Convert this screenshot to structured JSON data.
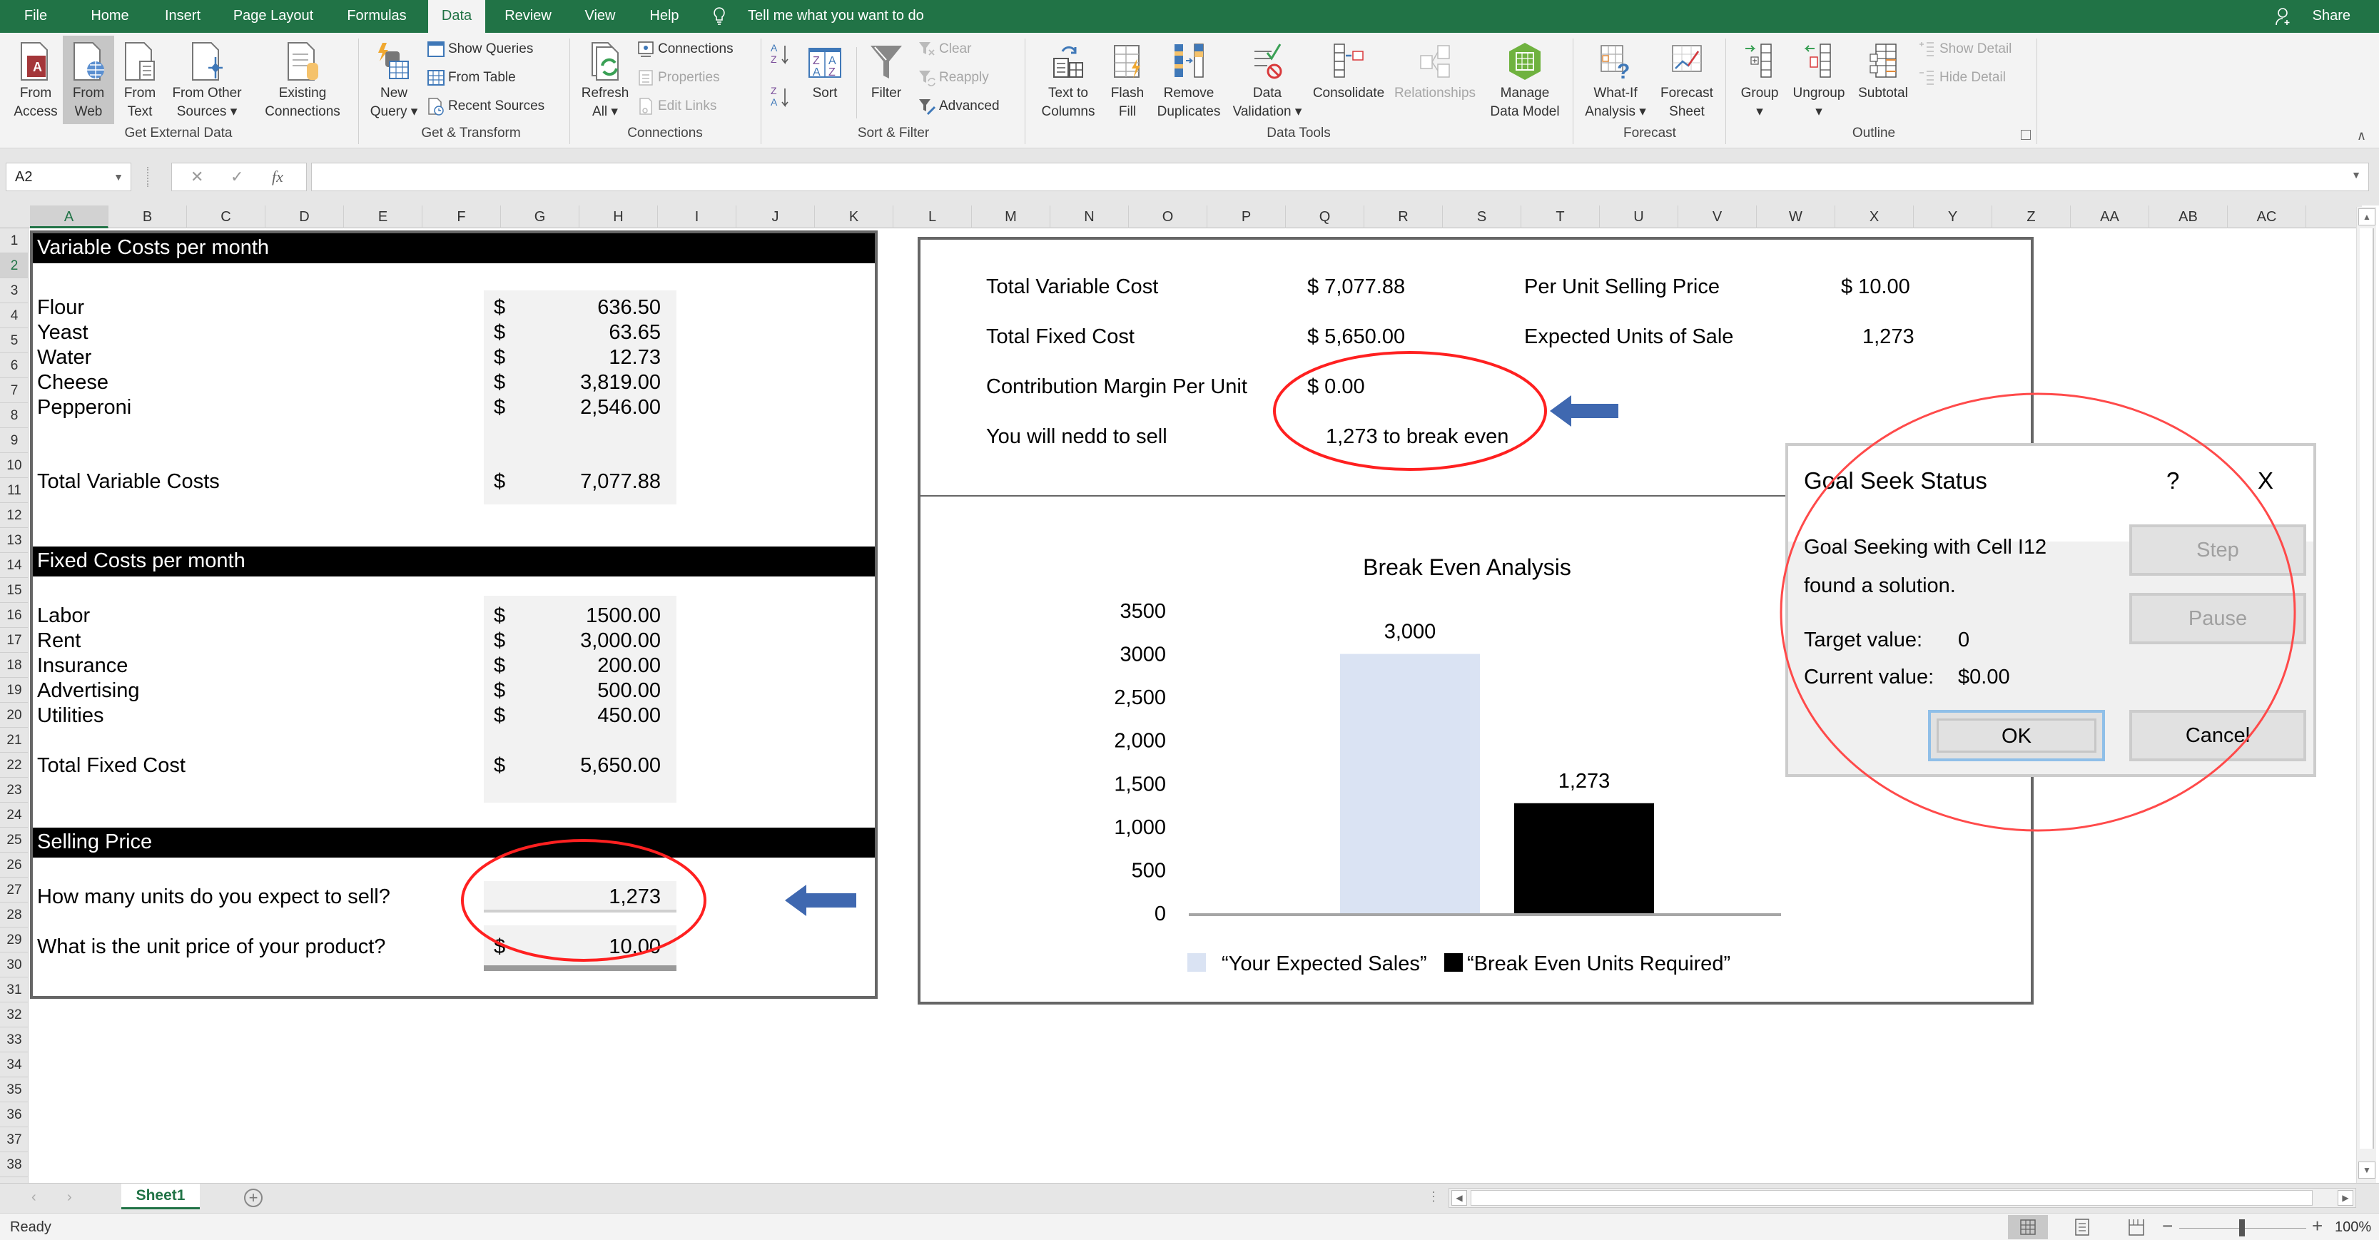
{
  "ribbon_tabs": [
    "File",
    "Home",
    "Insert",
    "Page Layout",
    "Formulas",
    "Data",
    "Review",
    "View",
    "Help"
  ],
  "active_tab": "Data",
  "tell_me": "Tell me what you want to do",
  "share": "Share",
  "ribbon": {
    "get_external_data": {
      "label": "Get External Data",
      "buttons": [
        {
          "line1": "From",
          "line2": "Access",
          "icon": "access-database-icon"
        },
        {
          "line1": "From",
          "line2": "Web",
          "icon": "web-globe-icon"
        },
        {
          "line1": "From",
          "line2": "Text",
          "icon": "text-file-icon"
        },
        {
          "line1": "From Other",
          "line2": "Sources ▾",
          "icon": "other-sources-icon"
        },
        {
          "line1": "Existing",
          "line2": "Connections",
          "icon": "existing-connections-icon"
        }
      ]
    },
    "get_transform": {
      "label": "Get & Transform",
      "new_query": {
        "line1": "New",
        "line2": "Query ▾"
      },
      "small": [
        "Show Queries",
        "From Table",
        "Recent Sources"
      ]
    },
    "connections": {
      "label": "Connections",
      "refresh": {
        "line1": "Refresh",
        "line2": "All ▾"
      },
      "small": [
        "Connections",
        "Properties",
        "Edit Links"
      ]
    },
    "sort_filter": {
      "label": "Sort & Filter",
      "sort": "Sort",
      "filter": "Filter",
      "small": [
        "Clear",
        "Reapply",
        "Advanced"
      ]
    },
    "data_tools": {
      "label": "Data Tools",
      "buttons": [
        {
          "line1": "Text to",
          "line2": "Columns"
        },
        {
          "line1": "Flash",
          "line2": "Fill"
        },
        {
          "line1": "Remove",
          "line2": "Duplicates"
        },
        {
          "line1": "Data",
          "line2": "Validation ▾"
        },
        {
          "line1": "Consolidate",
          "line2": ""
        },
        {
          "line1": "Relationships",
          "line2": ""
        },
        {
          "line1": "Manage",
          "line2": "Data Model"
        }
      ]
    },
    "forecast": {
      "label": "Forecast",
      "buttons": [
        {
          "line1": "What-If",
          "line2": "Analysis ▾"
        },
        {
          "line1": "Forecast",
          "line2": "Sheet"
        }
      ]
    },
    "outline": {
      "label": "Outline",
      "buttons": [
        {
          "line1": "Group",
          "line2": "▾"
        },
        {
          "line1": "Ungroup",
          "line2": "▾"
        },
        {
          "line1": "Subtotal",
          "line2": ""
        }
      ],
      "small": [
        "Show Detail",
        "Hide Detail"
      ]
    }
  },
  "formula_bar": {
    "name_box": "A2",
    "cancel": "✕",
    "enter": "✓",
    "fx": "fx",
    "value": ""
  },
  "columns": [
    "A",
    "B",
    "C",
    "D",
    "E",
    "F",
    "G",
    "H",
    "I",
    "J",
    "K",
    "L",
    "M",
    "N",
    "O",
    "P",
    "Q",
    "R",
    "S",
    "T",
    "U",
    "V",
    "W",
    "X",
    "Y",
    "Z",
    "AA",
    "AB",
    "AC"
  ],
  "selected_column": "A",
  "rows": [
    1,
    2,
    3,
    4,
    5,
    6,
    7,
    8,
    9,
    10,
    11,
    12,
    13,
    14,
    15,
    16,
    17,
    18,
    19,
    20,
    21,
    22,
    23,
    24,
    25,
    26,
    27,
    28,
    29,
    30,
    31,
    32,
    33,
    34,
    35,
    36,
    37,
    38
  ],
  "selected_row": 2,
  "variable_costs": {
    "header": "Variable Costs per month",
    "items": [
      {
        "label": "Flour",
        "currency": "$",
        "amount": "636.50"
      },
      {
        "label": "Yeast",
        "currency": "$",
        "amount": "63.65"
      },
      {
        "label": "Water",
        "currency": "$",
        "amount": "12.73"
      },
      {
        "label": "Cheese",
        "currency": "$",
        "amount": "3,819.00"
      },
      {
        "label": "Pepperoni",
        "currency": "$",
        "amount": "2,546.00"
      }
    ],
    "total_label": "Total Variable Costs",
    "total_currency": "$",
    "total_amount": "7,077.88"
  },
  "fixed_costs": {
    "header": "Fixed Costs per month",
    "items": [
      {
        "label": "Labor",
        "currency": "$",
        "amount": "1500.00"
      },
      {
        "label": "Rent",
        "currency": "$",
        "amount": "3,000.00"
      },
      {
        "label": "Insurance",
        "currency": "$",
        "amount": "200.00"
      },
      {
        "label": "Advertising",
        "currency": "$",
        "amount": "500.00"
      },
      {
        "label": "Utilities",
        "currency": "$",
        "amount": "450.00"
      }
    ],
    "total_label": "Total Fixed Cost",
    "total_currency": "$",
    "total_amount": "5,650.00"
  },
  "selling_price": {
    "header": "Selling Price",
    "units_question": "How many units do you expect to sell?",
    "units_value": "1,273",
    "price_question": "What is the unit price of your product?",
    "price_currency": "$",
    "price_value": "10.00"
  },
  "summary": {
    "total_variable_cost_label": "Total Variable Cost",
    "total_variable_cost": "$ 7,077.88",
    "total_fixed_cost_label": "Total Fixed Cost",
    "total_fixed_cost": "$ 5,650.00",
    "contribution_margin_label": "Contribution Margin Per Unit",
    "contribution_margin": "$ 0.00",
    "need_to_sell_label": "You will nedd to sell",
    "need_to_sell": "1,273 to break even",
    "per_unit_price_label": "Per Unit Selling Price",
    "per_unit_price": "$ 10.00",
    "expected_units_label": "Expected Units of Sale",
    "expected_units": "1,273"
  },
  "chart_data": {
    "type": "bar",
    "title": "Break Even Analysis",
    "categories": [
      "“Your Expected Sales”",
      "“Break Even Units Required”"
    ],
    "series": [
      {
        "name": "“Your Expected Sales”",
        "values": [
          3000
        ],
        "color": "#dae3f3"
      },
      {
        "name": "“Break Even Units Required”",
        "values": [
          1273
        ],
        "color": "#000000"
      }
    ],
    "data_labels": [
      "3,000",
      "1,273"
    ],
    "y_ticks": [
      "0",
      "500",
      "1,000",
      "1,500",
      "2,000",
      "2,500",
      "3000",
      "3500"
    ],
    "y_tick_values": [
      0,
      500,
      1000,
      1500,
      2000,
      2500,
      3000,
      3500
    ],
    "ylim": [
      0,
      3500
    ],
    "xlabel": "",
    "ylabel": "",
    "grid": false,
    "legend": "bottom"
  },
  "goal_seek": {
    "title": "Goal Seek Status",
    "help": "?",
    "close": "X",
    "line1": "Goal Seeking with Cell I12",
    "line2": "found a solution.",
    "target_label": "Target value:",
    "target_value": "0",
    "current_label": "Current value:",
    "current_value": "$0.00",
    "step": "Step",
    "pause": "Pause",
    "ok": "OK",
    "cancel": "Cancel"
  },
  "annotation_colors": {
    "circle": "#ff2020",
    "arrow": "#3f68b0"
  },
  "sheet_tabs": [
    "Sheet1"
  ],
  "status": {
    "ready": "Ready",
    "zoom": "100%",
    "zoom_fraction": 0.5
  }
}
